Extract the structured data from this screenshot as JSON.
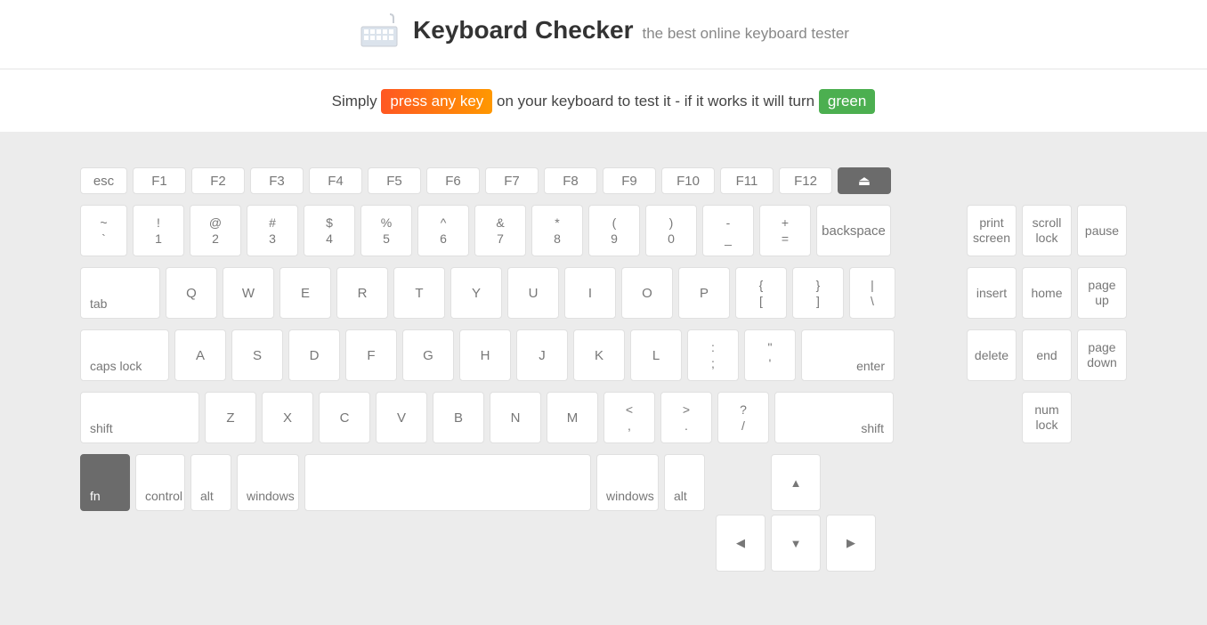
{
  "header": {
    "title": "Keyboard Checker",
    "subtitle": "the best online keyboard tester"
  },
  "instruction": {
    "pre": "Simply ",
    "badge1": "press any key",
    "mid": " on your keyboard to test it - if it works it will turn ",
    "badge2": "green"
  },
  "keys": {
    "esc": "esc",
    "f1": "F1",
    "f2": "F2",
    "f3": "F3",
    "f4": "F4",
    "f5": "F5",
    "f6": "F6",
    "f7": "F7",
    "f8": "F8",
    "f9": "F9",
    "f10": "F10",
    "f11": "F11",
    "f12": "F12",
    "eject": "⏏",
    "tilde_top": "~",
    "tilde_bot": "`",
    "n1_top": "!",
    "n1_bot": "1",
    "n2_top": "@",
    "n2_bot": "2",
    "n3_top": "#",
    "n3_bot": "3",
    "n4_top": "$",
    "n4_bot": "4",
    "n5_top": "%",
    "n5_bot": "5",
    "n6_top": "^",
    "n6_bot": "6",
    "n7_top": "&",
    "n7_bot": "7",
    "n8_top": "*",
    "n8_bot": "8",
    "n9_top": "(",
    "n9_bot": "9",
    "n0_top": ")",
    "n0_bot": "0",
    "dash_top": "-",
    "dash_bot": "_",
    "eq_top": "+",
    "eq_bot": "=",
    "backspace": "backspace",
    "tab": "tab",
    "q": "Q",
    "w": "W",
    "e": "E",
    "r": "R",
    "t": "T",
    "y": "Y",
    "u": "U",
    "i": "I",
    "o": "O",
    "p": "P",
    "lb_top": "{",
    "lb_bot": "[",
    "rb_top": "}",
    "rb_bot": "]",
    "bs_top": "|",
    "bs_bot": "\\",
    "caps": "caps lock",
    "a": "A",
    "s": "S",
    "d": "D",
    "f": "F",
    "g": "G",
    "h": "H",
    "j": "J",
    "k": "K",
    "l": "L",
    "sc_top": ":",
    "sc_bot": ";",
    "qt_top": "\"",
    "qt_bot": "'",
    "enter": "enter",
    "lshift": "shift",
    "z": "Z",
    "x": "X",
    "c": "C",
    "v": "V",
    "b": "B",
    "n": "N",
    "m": "M",
    "cm_top": "<",
    "cm_bot": ",",
    "pd_top": ">",
    "pd_bot": ".",
    "sl_top": "?",
    "sl_bot": "/",
    "rshift": "shift",
    "fn": "fn",
    "ctrl": "control",
    "alt": "alt",
    "win": "windows",
    "rwin": "windows",
    "ralt": "alt",
    "up": "▲",
    "down": "▼",
    "left": "◀",
    "right": "▶",
    "prtsc": "print screen",
    "scrlk": "scroll lock",
    "pause": "pause",
    "insert": "insert",
    "home": "home",
    "pgup": "page up",
    "delete": "delete",
    "end": "end",
    "pgdn": "page down",
    "numlk": "num lock"
  }
}
